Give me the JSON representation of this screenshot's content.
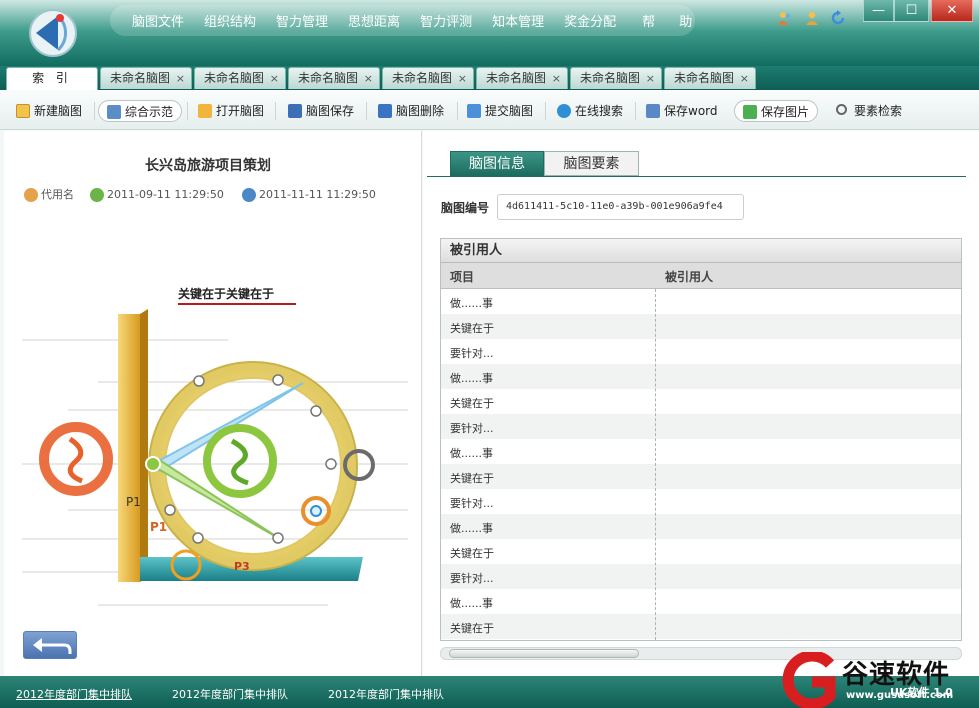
{
  "menu": [
    "脑图文件",
    "组织结构",
    "智力管理",
    "思想距离",
    "智力评测",
    "知本管理",
    "奖金分配",
    "帮 助"
  ],
  "window": {
    "min": "—",
    "max": "☐",
    "close": "✕"
  },
  "tabs": {
    "active": "索 引",
    "items": [
      "未命名脑图",
      "未命名脑图",
      "未命名脑图",
      "未命名脑图",
      "未命名脑图",
      "未命名脑图",
      "未命名脑图"
    ],
    "close": "×"
  },
  "toolbar": {
    "new": "新建脑图",
    "demo": "综合示范",
    "open": "打开脑图",
    "save": "脑图保存",
    "delete": "脑图删除",
    "submit": "提交脑图",
    "search": "在线搜索",
    "word": "保存word",
    "image": "保存图片",
    "elements": "要素检索"
  },
  "doc": {
    "title": "长兴岛旅游项目策划",
    "author": "代用名",
    "created": "2011-09-11 11:29:50",
    "modified": "2011-11-11 11:29:50"
  },
  "diagram": {
    "heading": "关键在于关键在于",
    "label_p1_dark": "P1",
    "label_p1_orange": "P1",
    "label_p3": "P3"
  },
  "right": {
    "tab_info": "脑图信息",
    "tab_elements": "脑图要素",
    "id_label": "脑图编号",
    "id_value": "4d611411-5c10-11e0-a39b-001e906a9fe4"
  },
  "grid": {
    "title": "被引用人",
    "columns": [
      "项目",
      "被引用人"
    ],
    "rows": [
      "做......事",
      "关键在于",
      "要针对...",
      "做......事",
      "关键在于",
      "要针对...",
      "做......事",
      "关键在于",
      "要针对...",
      "做......事",
      "关键在于",
      "要针对...",
      "做......事",
      "关键在于"
    ]
  },
  "status": {
    "link": "2012年度部门集中排队",
    "item2": "2012年度部门集中排队",
    "item3": "2012年度部门集中排队",
    "version": "UK软件 1.0"
  },
  "watermark": {
    "brand": "谷速软件",
    "url": "www.gususoft.com"
  },
  "colors": {
    "accent": "#1c6d60",
    "status_bar": "#0f5e53",
    "close": "#c0392b"
  }
}
